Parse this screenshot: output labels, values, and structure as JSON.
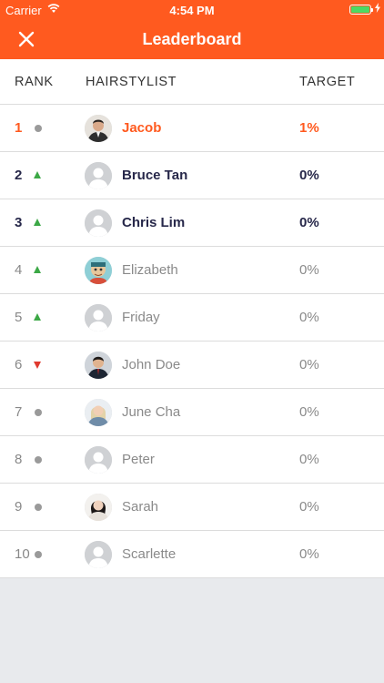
{
  "status_bar": {
    "carrier": "Carrier",
    "time": "4:54 PM"
  },
  "nav": {
    "title": "Leaderboard",
    "close_icon": "close-icon"
  },
  "table": {
    "headers": {
      "rank": "RANK",
      "stylist": "HAIRSTYLIST",
      "target": "TARGET"
    },
    "rows": [
      {
        "rank": "1",
        "trend": "same",
        "avatar": "photo",
        "name": "Jacob",
        "target": "1%",
        "style": "first"
      },
      {
        "rank": "2",
        "trend": "up",
        "avatar": "placeholder",
        "name": "Bruce Tan",
        "target": "0%",
        "style": "top"
      },
      {
        "rank": "3",
        "trend": "up",
        "avatar": "placeholder",
        "name": "Chris Lim",
        "target": "0%",
        "style": "top"
      },
      {
        "rank": "4",
        "trend": "up",
        "avatar": "photo",
        "name": "Elizabeth",
        "target": "0%",
        "style": "normal"
      },
      {
        "rank": "5",
        "trend": "up",
        "avatar": "placeholder",
        "name": "Friday",
        "target": "0%",
        "style": "normal"
      },
      {
        "rank": "6",
        "trend": "down",
        "avatar": "photo",
        "name": "John Doe",
        "target": "0%",
        "style": "normal"
      },
      {
        "rank": "7",
        "trend": "same",
        "avatar": "photo",
        "name": "June Cha",
        "target": "0%",
        "style": "normal"
      },
      {
        "rank": "8",
        "trend": "same",
        "avatar": "placeholder",
        "name": "Peter",
        "target": "0%",
        "style": "normal"
      },
      {
        "rank": "9",
        "trend": "same",
        "avatar": "photo",
        "name": "Sarah",
        "target": "0%",
        "style": "normal"
      },
      {
        "rank": "10",
        "trend": "same",
        "avatar": "placeholder",
        "name": "Scarlette",
        "target": "0%",
        "style": "normal"
      }
    ]
  },
  "colors": {
    "accent": "#ff5a1f",
    "trend_up": "#3ca846",
    "trend_down": "#e03a2f",
    "trend_same": "#9a9a9a",
    "top_text": "#27284a"
  }
}
